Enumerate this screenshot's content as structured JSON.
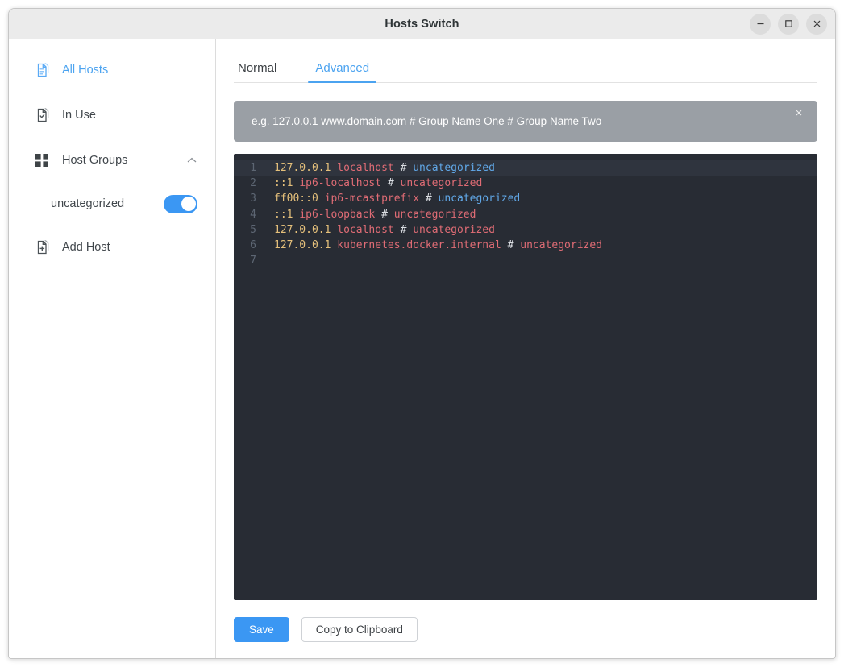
{
  "window": {
    "title": "Hosts Switch",
    "controls": [
      {
        "name": "minimize-button",
        "glyph": "minimize"
      },
      {
        "name": "maximize-button",
        "glyph": "maximize"
      },
      {
        "name": "close-button",
        "glyph": "close"
      }
    ]
  },
  "sidebar": {
    "items": [
      {
        "label": "All Hosts",
        "icon": "document-lines-icon",
        "active": true,
        "expandable": false
      },
      {
        "label": "In Use",
        "icon": "document-check-icon",
        "active": false,
        "expandable": false
      },
      {
        "label": "Host Groups",
        "icon": "grid-squares-icon",
        "active": false,
        "expandable": true,
        "chevron": "chevron-up-icon"
      },
      {
        "label": "Add Host",
        "icon": "document-plus-icon",
        "active": false,
        "expandable": false
      }
    ],
    "groups": [
      {
        "label": "uncategorized",
        "enabled": true
      }
    ]
  },
  "main": {
    "tabs": [
      {
        "label": "Normal",
        "active": false
      },
      {
        "label": "Advanced",
        "active": true
      }
    ],
    "alert": {
      "text": "e.g. 127.0.0.1 www.domain.com # Group Name One # Group Name Two",
      "close_glyph": "×"
    },
    "editor": {
      "lines": [
        {
          "num": "1",
          "current": true,
          "ip": "127.0.0.1",
          "host": "localhost",
          "hash": "#",
          "group": "uncategorized",
          "group_color": "blue"
        },
        {
          "num": "2",
          "current": false,
          "ip": "::1",
          "host": "ip6-localhost",
          "hash": "#",
          "group": "uncategorized",
          "group_color": "red"
        },
        {
          "num": "3",
          "current": false,
          "ip": "ff00::0",
          "host": "ip6-mcastprefix",
          "hash": "#",
          "group": "uncategorized",
          "group_color": "blue"
        },
        {
          "num": "4",
          "current": false,
          "ip": "::1",
          "host": "ip6-loopback",
          "hash": "#",
          "group": "uncategorized",
          "group_color": "red"
        },
        {
          "num": "5",
          "current": false,
          "ip": "127.0.0.1",
          "host": "localhost",
          "hash": "#",
          "group": "uncategorized",
          "group_color": "red"
        },
        {
          "num": "6",
          "current": false,
          "ip": "127.0.0.1",
          "host": "kubernetes.docker.internal",
          "hash": "#",
          "group": "uncategorized",
          "group_color": "red"
        },
        {
          "num": "7",
          "current": false,
          "ip": "",
          "host": "",
          "hash": "",
          "group": "",
          "group_color": "red"
        }
      ]
    },
    "buttons": {
      "save": "Save",
      "copy": "Copy to Clipboard"
    }
  },
  "colors": {
    "accent": "#3b97f3",
    "tab_active": "#4ba3f0",
    "editor_bg": "#282c34",
    "editor_current_line": "#2f343e",
    "line_number": "#5d6673",
    "token_ip": "#e5c07b",
    "token_host": "#e06c75",
    "token_hash": "#dcdfe4",
    "token_group_blue": "#61a8e8",
    "token_group_red": "#e06c75",
    "alert_bg": "#9a9fa5",
    "titlebar_bg": "#ebebeb"
  }
}
